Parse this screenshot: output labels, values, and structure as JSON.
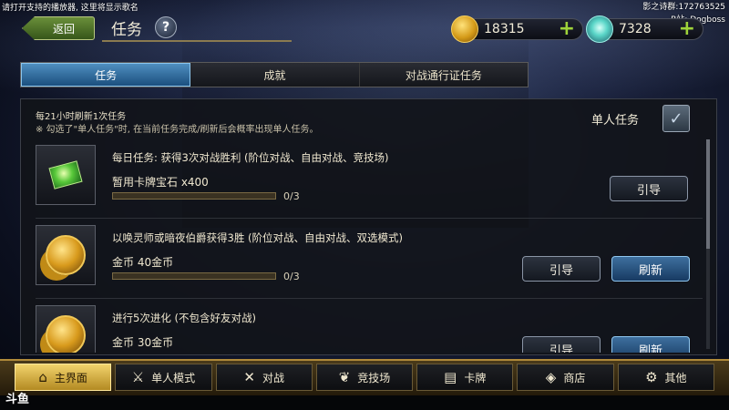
{
  "overlay": {
    "top_left_notice": "请打开支持的播放器, 这里将显示歌名",
    "top_right_line1": "影之诗群:172763525",
    "top_right_line2": "B站: Dogboss",
    "corner_logo": "斗鱼"
  },
  "header": {
    "back_label": "返回",
    "title": "任务",
    "help_glyph": "?"
  },
  "currency": {
    "gold": "18315",
    "crystal": "7328",
    "plus_glyph": "+"
  },
  "tabs": [
    {
      "label": "任务",
      "active": true
    },
    {
      "label": "成就",
      "active": false
    },
    {
      "label": "对战通行证任务",
      "active": false
    }
  ],
  "panel": {
    "refresh_note": "每21小时刷新1次任务",
    "solo_note": "※ 勾选了\"单人任务\"时, 在当前任务完成/刷新后会概率出现单人任务。",
    "solo_label": "单人任务",
    "solo_checked": true,
    "check_glyph": "✓"
  },
  "quests": [
    {
      "name": "每日任务: 获得3次对战胜利 (阶位对战、自由对战、竞技场)",
      "reward": "暂用卡牌宝石 x400",
      "progress": "0/3",
      "progress_fraction": 0,
      "buttons": [
        "引导"
      ]
    },
    {
      "name": "以唤灵师或暗夜伯爵获得3胜 (阶位对战、自由对战、双选模式)",
      "reward": "金币 40金币",
      "progress": "0/3",
      "progress_fraction": 0,
      "buttons": [
        "引导",
        "刷新"
      ]
    },
    {
      "name": "进行5次进化 (不包含好友对战)",
      "reward": "金币 30金币",
      "buttons": [
        "引导",
        "刷新"
      ]
    }
  ],
  "nav": [
    {
      "label": "主界面",
      "active": true
    },
    {
      "label": "单人模式",
      "active": false
    },
    {
      "label": "对战",
      "active": false
    },
    {
      "label": "竞技场",
      "active": false
    },
    {
      "label": "卡牌",
      "active": false
    },
    {
      "label": "商店",
      "active": false
    },
    {
      "label": "其他",
      "active": false
    }
  ],
  "colors": {
    "accent_blue": "#4f8fc0",
    "nav_gold": "#f2d36c",
    "plus_green": "#9fd33a"
  }
}
